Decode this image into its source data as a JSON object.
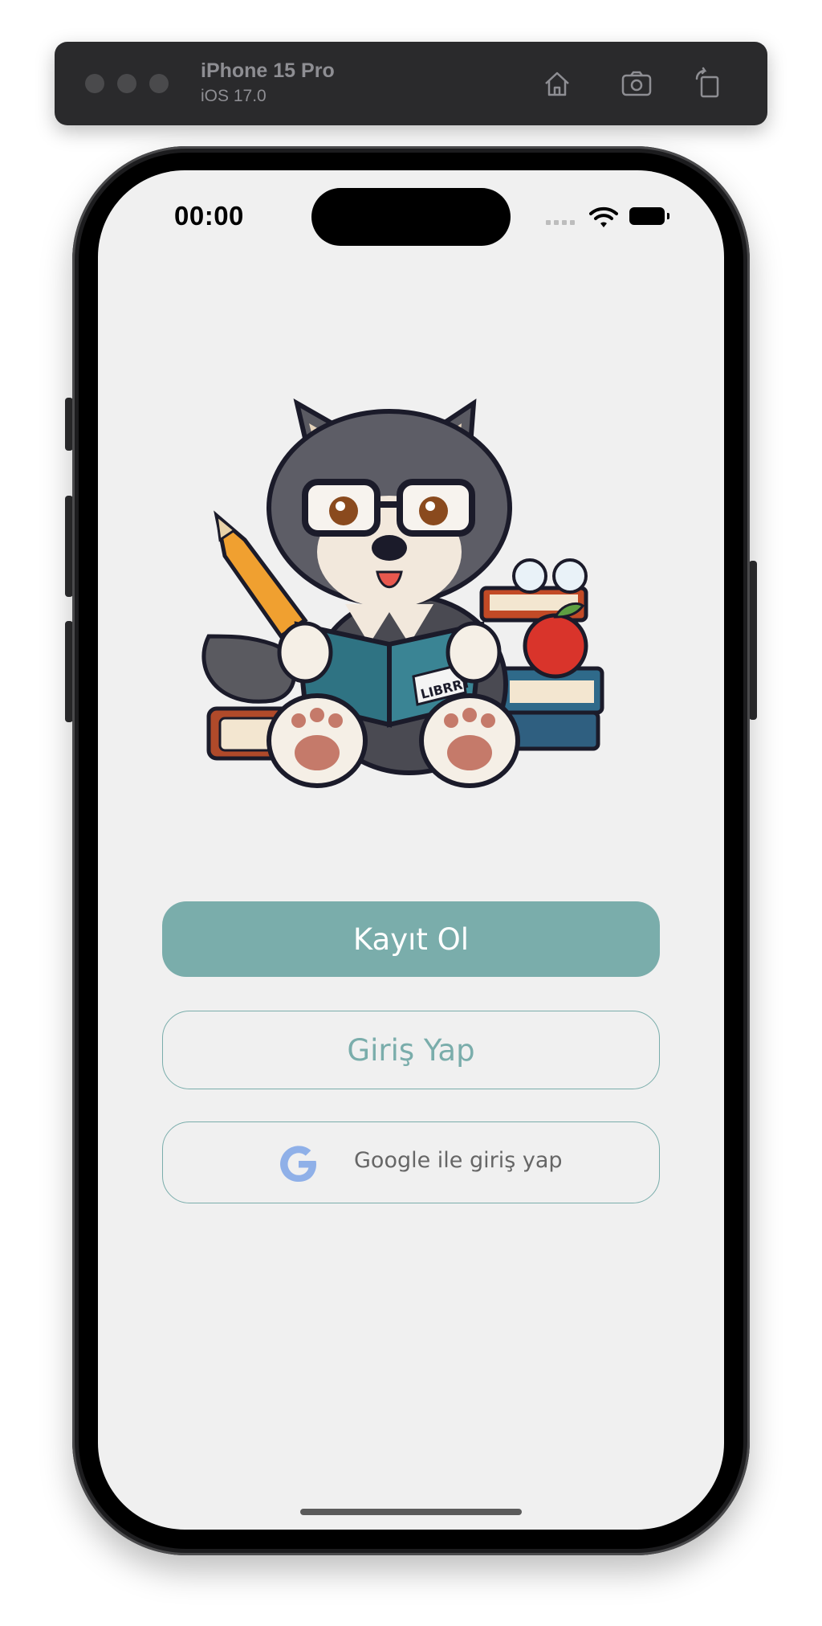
{
  "simulator": {
    "device_name": "iPhone 15 Pro",
    "os_version": "iOS 17.0",
    "toolbar_icons": [
      "home-icon",
      "screenshot-icon",
      "rotate-icon"
    ]
  },
  "status_bar": {
    "time": "00:00",
    "icons": [
      "cellular-signal-icon",
      "wifi-icon",
      "battery-icon"
    ]
  },
  "mascot": {
    "description_icon": "wolf-reading-book-icon",
    "book_label": "LIBRRY"
  },
  "actions": {
    "signup_label": "Kayıt Ol",
    "login_label": "Giriş Yap",
    "google_label": "Google ile giriş yap"
  },
  "colors": {
    "accent": "#7aadab",
    "background": "#f0f0f0",
    "google_blue": "#8fb0e8"
  }
}
